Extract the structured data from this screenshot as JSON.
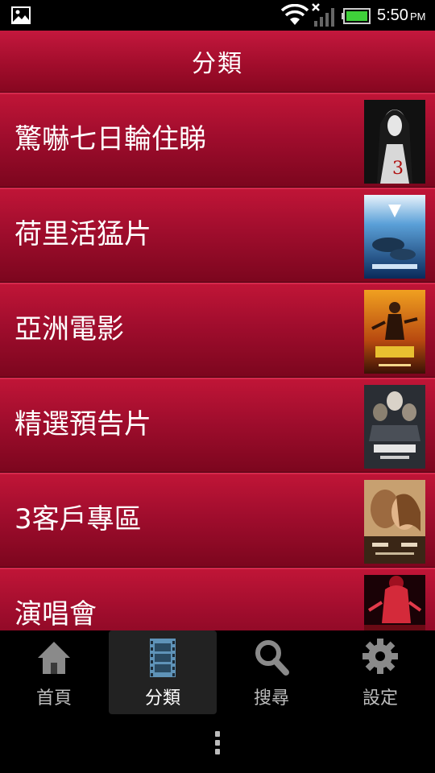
{
  "status_bar": {
    "time": "5:50",
    "ampm": "PM",
    "icons": [
      "picture-notification-icon",
      "wifi-icon",
      "signal-icon",
      "battery-icon"
    ]
  },
  "header": {
    "title": "分類"
  },
  "categories": [
    {
      "label": "驚嚇七日輪住睇",
      "thumb": "horror-poster"
    },
    {
      "label": "荷里活猛片",
      "thumb": "big-miracle-poster"
    },
    {
      "label": "亞洲電影",
      "thumb": "kungfu-poster"
    },
    {
      "label": "精選預告片",
      "thumb": "snow-white-poster"
    },
    {
      "label": "3客戶專區",
      "thumb": "nights-in-rodanthe-poster"
    },
    {
      "label": "演唱會",
      "thumb": "concert-poster"
    }
  ],
  "tabs": [
    {
      "label": "首頁",
      "icon": "home-icon",
      "active": false
    },
    {
      "label": "分類",
      "icon": "film-icon",
      "active": true
    },
    {
      "label": "搜尋",
      "icon": "search-icon",
      "active": false
    },
    {
      "label": "設定",
      "icon": "gear-icon",
      "active": false
    }
  ],
  "colors": {
    "accent": "#a50f2e",
    "tab_active_bg": "#222222",
    "status_bar": "#000000"
  }
}
